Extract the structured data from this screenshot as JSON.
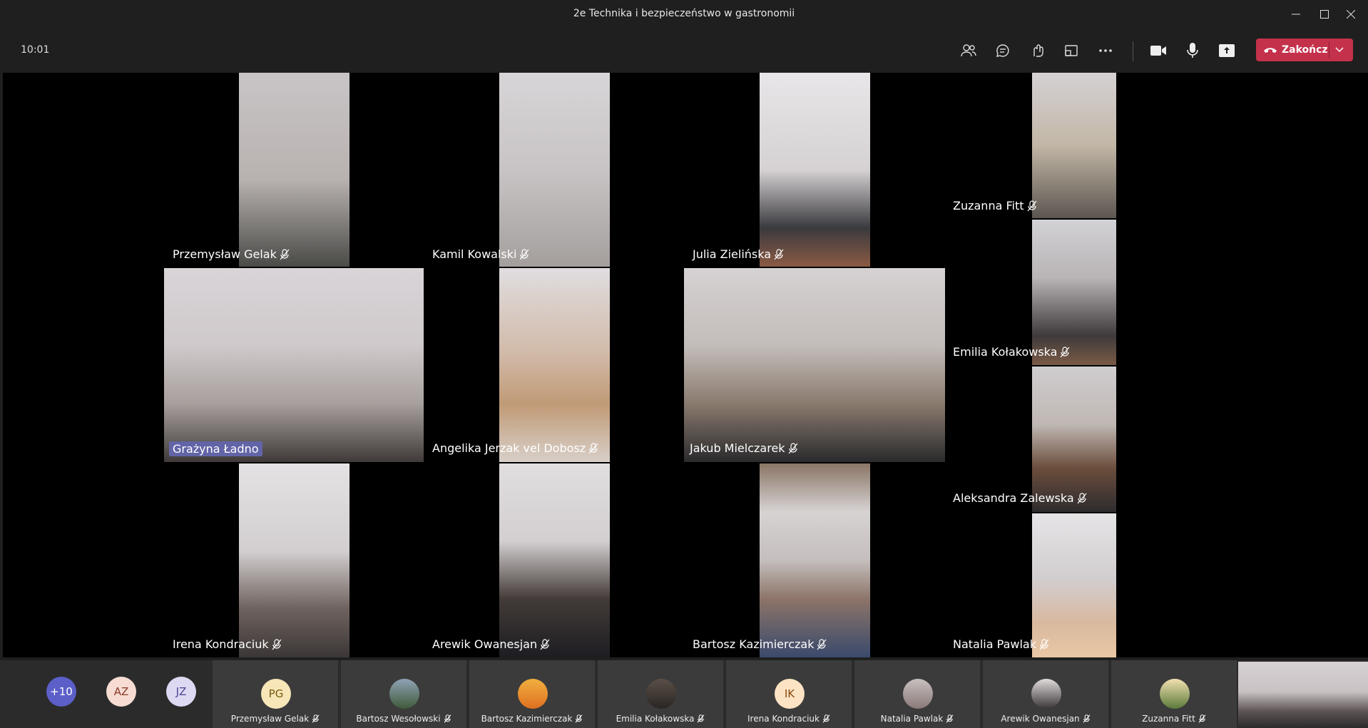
{
  "window": {
    "title": "2e Technika i bezpieczeństwo w gastronomii"
  },
  "toolbar": {
    "time": "10:01",
    "hangup_label": "Zakończ",
    "icons": [
      "participants-icon",
      "chat-icon",
      "reactions-icon",
      "rooms-icon",
      "more-icon",
      "camera-icon",
      "mic-icon",
      "share-icon"
    ]
  },
  "grid": {
    "tiles": [
      {
        "name": "Przemysław Gelak"
      },
      {
        "name": "Kamil Kowalski"
      },
      {
        "name": "Julia Zielińska"
      },
      {
        "name": "Zuzanna Fitt"
      },
      {
        "name": "Grażyna Ładno"
      },
      {
        "name": "Angelika Jerzak vel Dobosz"
      },
      {
        "name": "Jakub Mielczarek"
      },
      {
        "name": "Emilia Kołakowska"
      },
      {
        "name": "Irena Kondraciuk"
      },
      {
        "name": "Arewik Owanesjan"
      },
      {
        "name": "Bartosz Kazimierczak"
      },
      {
        "name": "Aleksandra Zalewska"
      },
      {
        "name": "Natalia Pawlak"
      }
    ]
  },
  "strip": {
    "overflow_count": "+10",
    "initial_avatars": [
      "AZ",
      "JZ"
    ],
    "participants": [
      {
        "name": "Przemysław Gelak",
        "initials": "PG"
      },
      {
        "name": "Bartosz Wesołowski",
        "initials": ""
      },
      {
        "name": "Bartosz Kazimierczak",
        "initials": ""
      },
      {
        "name": "Emilia Kołakowska",
        "initials": ""
      },
      {
        "name": "Irena Kondraciuk",
        "initials": "IK"
      },
      {
        "name": "Natalia Pawlak",
        "initials": ""
      },
      {
        "name": "Arewik Owanesjan",
        "initials": ""
      },
      {
        "name": "Zuzanna Fitt",
        "initials": ""
      }
    ]
  },
  "colors": {
    "accent": "#6264a7",
    "hangup": "#c4314b",
    "background": "#1f1f1f"
  }
}
